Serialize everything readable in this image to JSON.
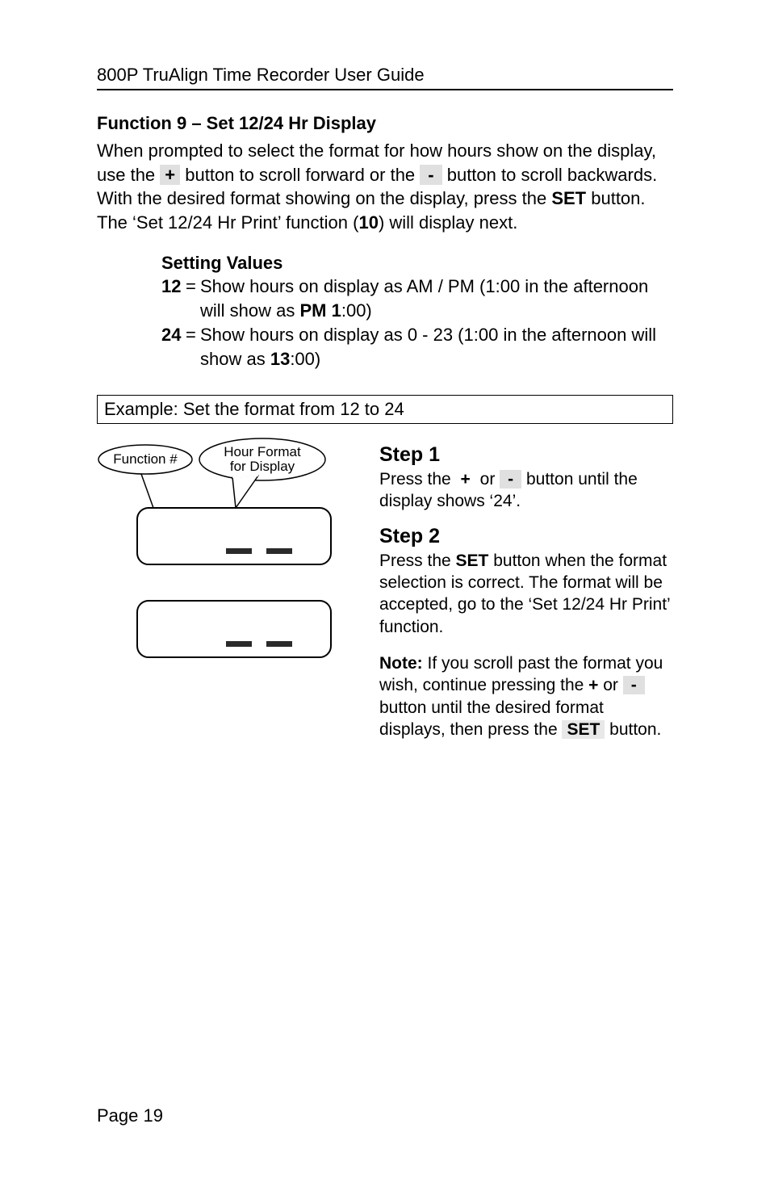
{
  "header": {
    "title": "800P TruAlign Time Recorder User Guide"
  },
  "section": {
    "title": "Function 9 – Set 12/24 Hr Display",
    "intro_1": "When prompted to select the format for how hours show on the display, use the ",
    "plus": "+",
    "intro_2": " button to scroll forward or the ",
    "minus": "-",
    "intro_3": " button to scroll backwards. With the desired format showing on the display, press the ",
    "set": "SET",
    "intro_4": " button. The ‘Set 12/24 Hr Print’ function (",
    "ten": "10",
    "intro_5": ") will display next."
  },
  "settings": {
    "heading": "Setting Values",
    "row1_key": "12",
    "row1_val_a": "Show hours on display as AM / PM (1:00 in the afternoon will show as ",
    "row1_val_b": "PM 1",
    "row1_val_c": ":00)",
    "row2_key": "24",
    "row2_val_a": "Show hours on display as 0 - 23 (1:00 in the afternoon will show as ",
    "row2_val_b": "13",
    "row2_val_c": ":00)"
  },
  "example": {
    "label": "Example: Set the format from 12 to 24"
  },
  "callouts": {
    "function": "Function #",
    "hourformat1": "Hour Format",
    "hourformat2": "for Display"
  },
  "step1": {
    "title": "Step 1",
    "a": "Press the ",
    "plus": "+",
    "b": " or ",
    "minus": "-",
    "c": " button until the display shows ‘24’."
  },
  "step2": {
    "title": "Step 2",
    "a": "Press the ",
    "set": "SET",
    "b": " button when the format selection is correct. The format will be accepted, go to the ‘Set 12/24 Hr Print’ function."
  },
  "note": {
    "label": "Note:",
    "a": " If you scroll past the format you wish, continue pressing the ",
    "plus": "+",
    "b": " or ",
    "minus": "-",
    "c": " button until the desired format displays, then press the ",
    "set": "SET",
    "d": " button."
  },
  "footer": {
    "page": "Page 19"
  }
}
